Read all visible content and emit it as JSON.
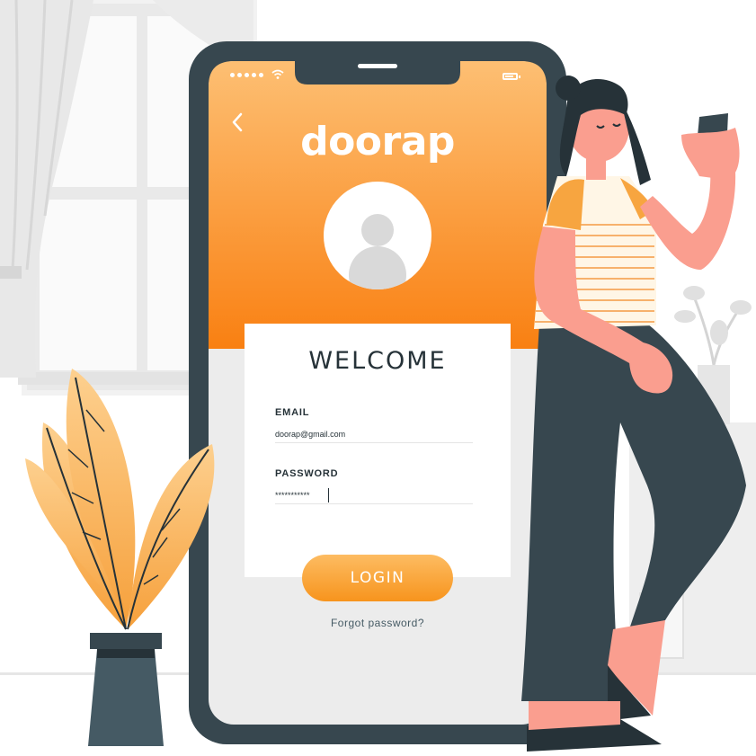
{
  "app": {
    "brand_name": "doorap"
  },
  "login": {
    "title": "WELCOME",
    "email": {
      "label": "EMAIL",
      "value": "doorap@gmail.com"
    },
    "password": {
      "label": "PASSWORD",
      "value": "***********"
    },
    "login_button": "LOGIN",
    "forgot_password": "Forgot password?"
  },
  "colors": {
    "accent_orange": "#f7941d",
    "accent_light": "#fdbc62",
    "phone_frame": "#37474f",
    "text_dark": "#263238",
    "skin": "#fa9e8f"
  },
  "icons": [
    "signal-icon",
    "wifi-icon",
    "battery-icon",
    "back-arrow-icon",
    "user-avatar-icon"
  ]
}
